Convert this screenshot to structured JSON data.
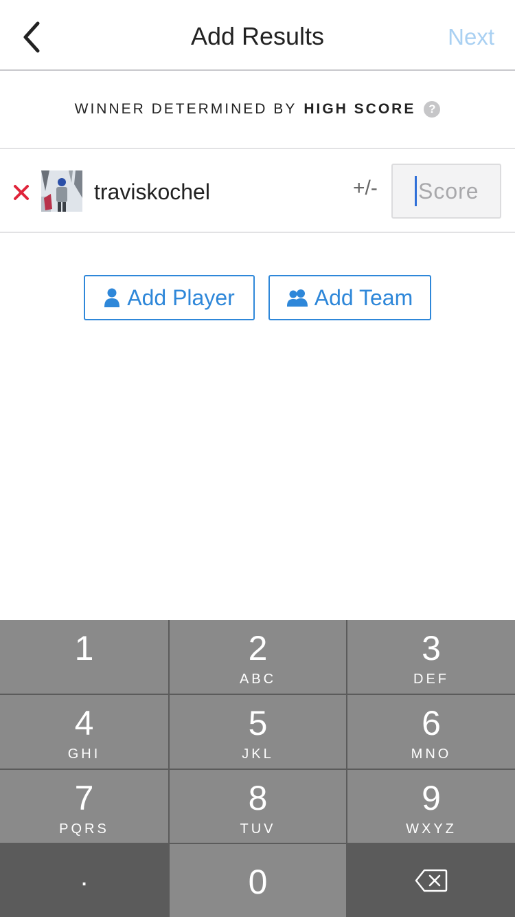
{
  "nav": {
    "title": "Add Results",
    "next_label": "Next"
  },
  "winner": {
    "prefix": "WINNER DETERMINED BY",
    "criteria": "HIGH SCORE",
    "help_glyph": "?"
  },
  "player": {
    "name": "traviskochel",
    "plusminus_label": "+/-",
    "score_placeholder": "Score",
    "score_value": ""
  },
  "actions": {
    "add_player_label": "Add Player",
    "add_team_label": "Add Team"
  },
  "keypad": {
    "keys": [
      {
        "digit": "1",
        "letters": ""
      },
      {
        "digit": "2",
        "letters": "ABC"
      },
      {
        "digit": "3",
        "letters": "DEF"
      },
      {
        "digit": "4",
        "letters": "GHI"
      },
      {
        "digit": "5",
        "letters": "JKL"
      },
      {
        "digit": "6",
        "letters": "MNO"
      },
      {
        "digit": "7",
        "letters": "PQRS"
      },
      {
        "digit": "8",
        "letters": "TUV"
      },
      {
        "digit": "9",
        "letters": "WXYZ"
      }
    ],
    "dot_label": ".",
    "zero_label": "0"
  },
  "colors": {
    "accent": "#2e87d9",
    "next_disabled": "#a9d0f2",
    "remove": "#e0243a",
    "key": "#8a8a8a",
    "key_dark": "#5b5b5b"
  },
  "icons": {
    "back": "chevron-left-icon",
    "remove": "close-icon",
    "add_player": "person-icon",
    "add_team": "people-icon",
    "backspace": "backspace-icon"
  }
}
